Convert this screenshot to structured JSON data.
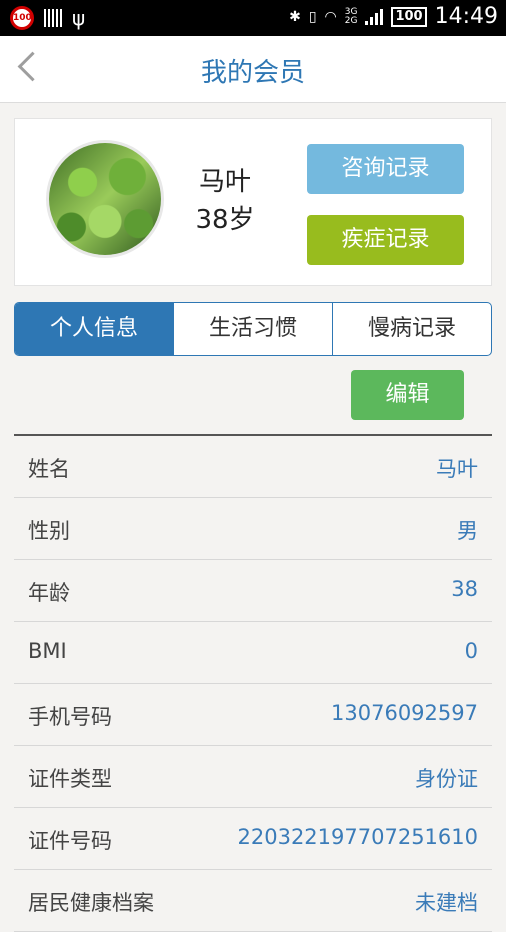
{
  "status_bar": {
    "badge": "100",
    "net_top": "3G",
    "net_bottom": "2G",
    "battery": "100",
    "time": "14:49"
  },
  "header": {
    "title": "我的会员"
  },
  "profile": {
    "name": "马叶",
    "age": "38岁",
    "consult_button": "咨询记录",
    "disease_button": "疾症记录"
  },
  "tabs": [
    {
      "label": "个人信息",
      "active": true
    },
    {
      "label": "生活习惯",
      "active": false
    },
    {
      "label": "慢病记录",
      "active": false
    }
  ],
  "edit_button": "编辑",
  "info": [
    {
      "label": "姓名",
      "value": "马叶"
    },
    {
      "label": "性别",
      "value": "男"
    },
    {
      "label": "年龄",
      "value": "38"
    },
    {
      "label": "BMI",
      "value": "0"
    },
    {
      "label": "手机号码",
      "value": "13076092597"
    },
    {
      "label": "证件类型",
      "value": "身份证"
    },
    {
      "label": "证件号码",
      "value": "220322197707251610"
    },
    {
      "label": "居民健康档案",
      "value": "未建档"
    }
  ],
  "colors": {
    "accent": "#2e77b4",
    "consult": "#74b9de",
    "disease": "#98bc1e",
    "edit": "#5cb85c"
  }
}
